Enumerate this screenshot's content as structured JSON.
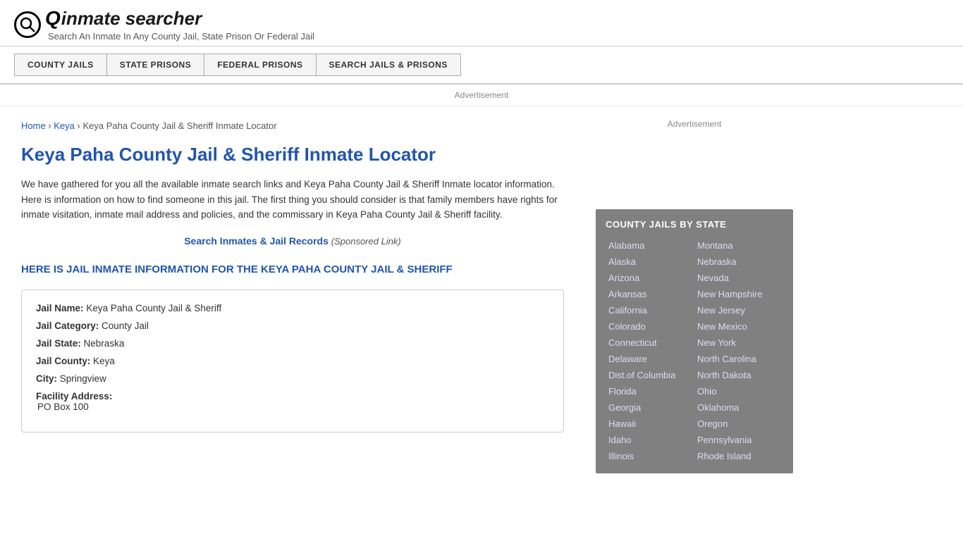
{
  "header": {
    "logo_icon": "🔍",
    "logo_text": "inmate searcher",
    "tagline": "Search An Inmate In Any County Jail, State Prison Or Federal Jail"
  },
  "nav": {
    "items": [
      {
        "id": "county-jails",
        "label": "COUNTY JAILS"
      },
      {
        "id": "state-prisons",
        "label": "STATE PRISONS"
      },
      {
        "id": "federal-prisons",
        "label": "FEDERAL PRISONS"
      },
      {
        "id": "search-jails",
        "label": "SEARCH JAILS & PRISONS"
      }
    ]
  },
  "ad_label": "Advertisement",
  "breadcrumb": {
    "home": "Home",
    "separator": "›",
    "keya": "Keya",
    "current": "Keya Paha County Jail & Sheriff Inmate Locator"
  },
  "page_title": "Keya Paha County Jail & Sheriff Inmate Locator",
  "description": "We have gathered for you all the available inmate search links and Keya Paha County Jail & Sheriff Inmate locator information. Here is information on how to find someone in this jail. The first thing you should consider is that family members have rights for inmate visitation, inmate mail address and policies, and the commissary in Keya Paha County Jail & Sheriff facility.",
  "sponsored_link": {
    "text": "Search Inmates & Jail Records",
    "note": "(Sponsored Link)"
  },
  "inmate_info_heading": "HERE IS JAIL INMATE INFORMATION FOR THE KEYA PAHA COUNTY JAIL & SHERIFF",
  "jail_info": {
    "name_label": "Jail Name:",
    "name_value": "Keya Paha County Jail & Sheriff",
    "category_label": "Jail Category:",
    "category_value": "County Jail",
    "state_label": "Jail State:",
    "state_value": "Nebraska",
    "county_label": "Jail County:",
    "county_value": "Keya",
    "city_label": "City:",
    "city_value": "Springview",
    "address_label": "Facility Address:",
    "address_value": "PO Box 100"
  },
  "sidebar_ad_label": "Advertisement",
  "state_list": {
    "title": "COUNTY JAILS BY STATE",
    "left_column": [
      "Alabama",
      "Alaska",
      "Arizona",
      "Arkansas",
      "California",
      "Colorado",
      "Connecticut",
      "Delaware",
      "Dist.of Columbia",
      "Florida",
      "Georgia",
      "Hawaii",
      "Idaho",
      "Illinois"
    ],
    "right_column": [
      "Montana",
      "Nebraska",
      "Nevada",
      "New Hampshire",
      "New Jersey",
      "New Mexico",
      "New York",
      "North Carolina",
      "North Dakota",
      "Ohio",
      "Oklahoma",
      "Oregon",
      "Pennsylvania",
      "Rhode Island"
    ]
  }
}
